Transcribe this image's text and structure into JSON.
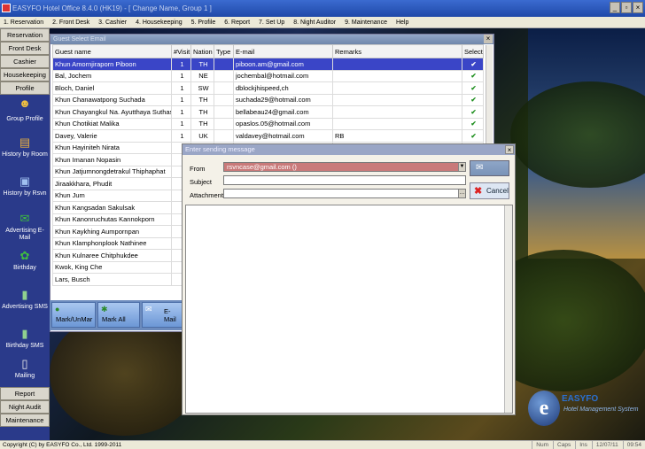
{
  "window": {
    "title": "EASYFO Hotel Office 8.4.0 (HK19) - [ Change Name, Group 1 ]",
    "app_icon": "app-icon"
  },
  "menu": [
    "1. Reservation",
    "2. Front Desk",
    "3. Cashier",
    "4. Housekeeping",
    "5. Profile",
    "6. Report",
    "7. Set Up",
    "8. Night Auditor",
    "9. Maintenance",
    "Help"
  ],
  "sidebar": {
    "top_buttons": [
      "Reservation",
      "Front Desk",
      "Cashier",
      "Housekeeping",
      "Profile"
    ],
    "icon_buttons": [
      {
        "label": "",
        "icon": "people-icon"
      },
      {
        "label": "Group Profile",
        "icon": "group-icon"
      },
      {
        "label": "History by Room",
        "icon": "folder-icon"
      },
      {
        "label": "History by Rsvn",
        "icon": "doc-icon"
      },
      {
        "label": "Advertising E-Mail",
        "icon": "email-icon"
      },
      {
        "label": "Birthday",
        "icon": "gift-icon"
      },
      {
        "label": "Advertising SMS",
        "icon": "phone-icon"
      },
      {
        "label": "Birthday SMS",
        "icon": "phone-icon"
      },
      {
        "label": "Mailing",
        "icon": "mail-icon"
      }
    ],
    "bottom_buttons": [
      "Report",
      "Night Audit",
      "Maintenance"
    ]
  },
  "grid": {
    "title": "Guest Select Email",
    "columns": [
      "Guest name",
      "#Visit",
      "Nation",
      "Type",
      "E-mail",
      "Remarks",
      "Select"
    ],
    "rows": [
      {
        "name": "Khun Amornjiraporn Piboon",
        "visit": "1",
        "nation": "TH",
        "type": "",
        "email": "piboon.am@gmail.com",
        "remarks": "",
        "select": "✔"
      },
      {
        "name": "Bal, Jochem",
        "visit": "1",
        "nation": "NE",
        "type": "",
        "email": "jochembal@hotmail.com",
        "remarks": "",
        "select": "✔"
      },
      {
        "name": "Bloch, Daniel",
        "visit": "1",
        "nation": "SW",
        "type": "",
        "email": "dblockjhispeed,ch",
        "remarks": "",
        "select": "✔"
      },
      {
        "name": "Khun Chanawatpong Suchada",
        "visit": "1",
        "nation": "TH",
        "type": "",
        "email": "suchada29@hotmail.com",
        "remarks": "",
        "select": "✔"
      },
      {
        "name": "Khun Chayangkul Na. Ayutthaya Suthasin",
        "visit": "1",
        "nation": "TH",
        "type": "",
        "email": "bellabeau24@gmail.com",
        "remarks": "",
        "select": "✔"
      },
      {
        "name": "Khun Chotikiat Malika",
        "visit": "1",
        "nation": "TH",
        "type": "",
        "email": "opaslos.05@hotmail.com",
        "remarks": "",
        "select": "✔"
      },
      {
        "name": "Davey, Valerie",
        "visit": "1",
        "nation": "UK",
        "type": "",
        "email": "valdavey@hotmail.com",
        "remarks": "RB",
        "select": "✔"
      },
      {
        "name": "Khun Hayiniteh Nirata",
        "visit": "",
        "nation": "",
        "type": "",
        "email": "",
        "remarks": "",
        "select": ""
      },
      {
        "name": "Khun Imanan Nopasin",
        "visit": "",
        "nation": "",
        "type": "",
        "email": "",
        "remarks": "",
        "select": ""
      },
      {
        "name": "Khun Jatjumnongdetrakul Thiphaphat",
        "visit": "",
        "nation": "",
        "type": "",
        "email": "",
        "remarks": "",
        "select": ""
      },
      {
        "name": "Jiraakkhara, Phudit",
        "visit": "",
        "nation": "",
        "type": "",
        "email": "",
        "remarks": "",
        "select": ""
      },
      {
        "name": "Khun Jum",
        "visit": "",
        "nation": "",
        "type": "",
        "email": "",
        "remarks": "",
        "select": ""
      },
      {
        "name": "Khun Kangsadan Sakulsak",
        "visit": "",
        "nation": "",
        "type": "",
        "email": "",
        "remarks": "",
        "select": ""
      },
      {
        "name": "Khun Kanonruchutas Kannokporn",
        "visit": "",
        "nation": "",
        "type": "",
        "email": "",
        "remarks": "",
        "select": ""
      },
      {
        "name": "Khun Kaykhing Aumpornpan",
        "visit": "",
        "nation": "",
        "type": "",
        "email": "",
        "remarks": "",
        "select": ""
      },
      {
        "name": "Khun Klamphonplook Nathinee",
        "visit": "",
        "nation": "",
        "type": "",
        "email": "",
        "remarks": "",
        "select": ""
      },
      {
        "name": "Khun Kulnaree Chitphukdee",
        "visit": "",
        "nation": "",
        "type": "",
        "email": "",
        "remarks": "",
        "select": ""
      },
      {
        "name": "Kwok, King Che",
        "visit": "",
        "nation": "",
        "type": "",
        "email": "",
        "remarks": "",
        "select": ""
      },
      {
        "name": "Lars, Busch",
        "visit": "",
        "nation": "",
        "type": "",
        "email": "",
        "remarks": "",
        "select": ""
      }
    ],
    "buttons": {
      "mark_unmark": "Mark/UnMar",
      "mark_all": "Mark All",
      "email": "E-Mail"
    }
  },
  "dialog": {
    "title": "Enter sending message",
    "from_label": "From",
    "from_value": "rsvncase@gmail.com ()",
    "subject_label": "Subject",
    "subject_value": "",
    "attachment_label": "Attachment",
    "attachment_value": "",
    "cancel_label": "Cancel"
  },
  "logo": {
    "brand": "EASYFO",
    "tagline": "Hotel Management System"
  },
  "status": {
    "copyright": "Copyright (C) by EASYFO Co., Ltd. 1999-2011",
    "num": "Num",
    "caps": "Caps",
    "ins": "Ins",
    "date": "12/07/11",
    "time": "09:54"
  },
  "colors": {
    "selection": "#3a45c7",
    "check": "#1e8f1e",
    "from_field": "#c97a7a",
    "sidebar": "#2a3a8a"
  }
}
